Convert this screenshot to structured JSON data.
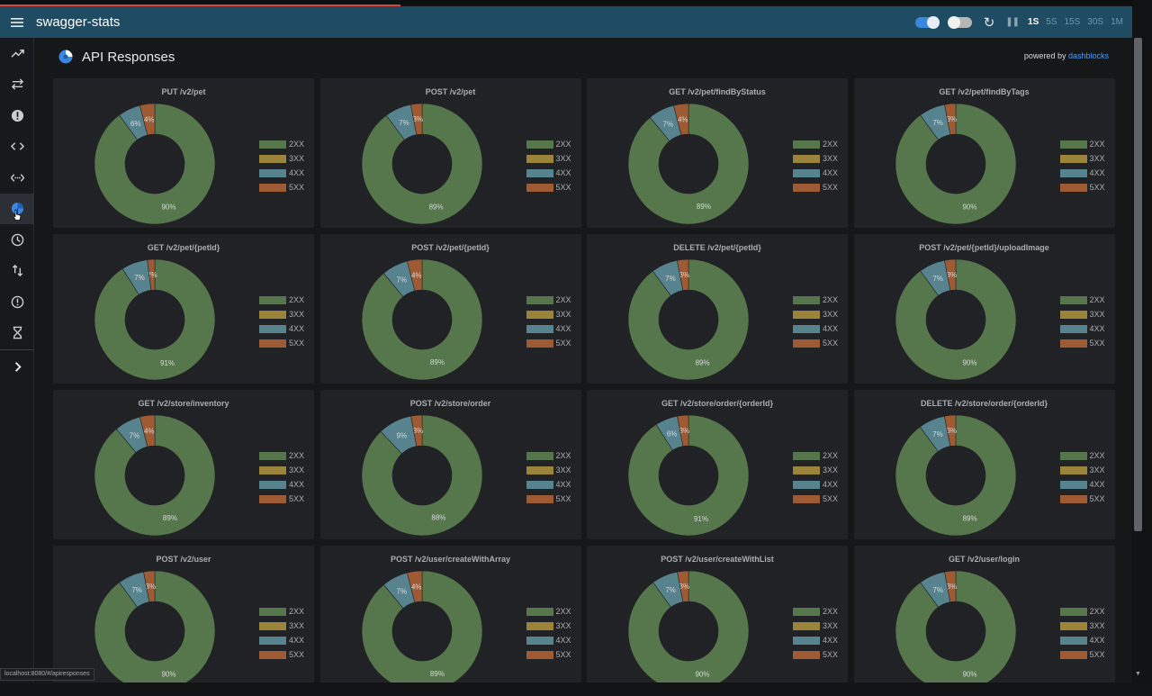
{
  "app": {
    "title": "swagger-stats"
  },
  "header": {
    "interval_options": [
      "1S",
      "5S",
      "15S",
      "30S",
      "1M"
    ],
    "active_interval": "1S",
    "icons": [
      "theme-toggle-icon",
      "autorefresh-toggle-icon",
      "refresh-icon",
      "pause-icon"
    ],
    "pause_glyph": "❚❚",
    "refresh_glyph": "↻"
  },
  "sidebar": {
    "items": [
      {
        "name": "sidebar-item-summary",
        "icon": "trending-up-icon"
      },
      {
        "name": "sidebar-item-requests",
        "icon": "swap-icon"
      },
      {
        "name": "sidebar-item-errors",
        "icon": "alert-circle-icon"
      },
      {
        "name": "sidebar-item-api",
        "icon": "code-icon"
      },
      {
        "name": "sidebar-item-api-operations",
        "icon": "api-ops-icon"
      },
      {
        "name": "sidebar-item-api-responses",
        "icon": "pie-chart-icon",
        "active": true
      },
      {
        "name": "sidebar-item-rates",
        "icon": "clock-icon"
      },
      {
        "name": "sidebar-item-payload",
        "icon": "up-down-icon"
      },
      {
        "name": "sidebar-item-alerts",
        "icon": "info-circle-icon"
      },
      {
        "name": "sidebar-item-longest",
        "icon": "hourglass-icon"
      },
      {
        "name": "sidebar-expand",
        "icon": "chevron-right-icon"
      }
    ]
  },
  "page": {
    "title": "API Responses",
    "powered_by": "powered by",
    "powered_link": "dashblocks"
  },
  "legend": [
    "2XX",
    "3XX",
    "4XX",
    "5XX"
  ],
  "colors": {
    "2XX": "#56764c",
    "3XX": "#9a8439",
    "4XX": "#57838f",
    "5XX": "#9e5b33",
    "header": "#1f4c63",
    "accent": "#3b86e0"
  },
  "chart_data": [
    {
      "type": "pie",
      "title": "PUT /v2/pet",
      "labels": [
        "2XX",
        "3XX",
        "4XX",
        "5XX"
      ],
      "values": [
        90,
        0,
        6,
        4
      ]
    },
    {
      "type": "pie",
      "title": "POST /v2/pet",
      "labels": [
        "2XX",
        "3XX",
        "4XX",
        "5XX"
      ],
      "values": [
        89,
        0,
        7,
        3
      ]
    },
    {
      "type": "pie",
      "title": "GET /v2/pet/findByStatus",
      "labels": [
        "2XX",
        "3XX",
        "4XX",
        "5XX"
      ],
      "values": [
        89,
        0,
        7,
        4
      ]
    },
    {
      "type": "pie",
      "title": "GET /v2/pet/findByTags",
      "labels": [
        "2XX",
        "3XX",
        "4XX",
        "5XX"
      ],
      "values": [
        90,
        0,
        7,
        3
      ]
    },
    {
      "type": "pie",
      "title": "GET /v2/pet/{petId}",
      "labels": [
        "2XX",
        "3XX",
        "4XX",
        "5XX"
      ],
      "values": [
        91,
        0,
        7,
        2
      ]
    },
    {
      "type": "pie",
      "title": "POST /v2/pet/{petId}",
      "labels": [
        "2XX",
        "3XX",
        "4XX",
        "5XX"
      ],
      "values": [
        89,
        0,
        7,
        4
      ]
    },
    {
      "type": "pie",
      "title": "DELETE /v2/pet/{petId}",
      "labels": [
        "2XX",
        "3XX",
        "4XX",
        "5XX"
      ],
      "values": [
        89,
        0,
        7,
        3
      ]
    },
    {
      "type": "pie",
      "title": "POST /v2/pet/{petId}/uploadImage",
      "labels": [
        "2XX",
        "3XX",
        "4XX",
        "5XX"
      ],
      "values": [
        90,
        0,
        7,
        3
      ]
    },
    {
      "type": "pie",
      "title": "GET /v2/store/inventory",
      "labels": [
        "2XX",
        "3XX",
        "4XX",
        "5XX"
      ],
      "values": [
        89,
        0,
        7,
        4
      ]
    },
    {
      "type": "pie",
      "title": "POST /v2/store/order",
      "labels": [
        "2XX",
        "3XX",
        "4XX",
        "5XX"
      ],
      "values": [
        88,
        0,
        9,
        3
      ]
    },
    {
      "type": "pie",
      "title": "GET /v2/store/order/{orderId}",
      "labels": [
        "2XX",
        "3XX",
        "4XX",
        "5XX"
      ],
      "values": [
        91,
        0,
        6,
        3
      ]
    },
    {
      "type": "pie",
      "title": "DELETE /v2/store/order/{orderId}",
      "labels": [
        "2XX",
        "3XX",
        "4XX",
        "5XX"
      ],
      "values": [
        89,
        0,
        7,
        3
      ]
    },
    {
      "type": "pie",
      "title": "POST /v2/user",
      "labels": [
        "2XX",
        "3XX",
        "4XX",
        "5XX"
      ],
      "values": [
        90,
        0,
        7,
        3
      ]
    },
    {
      "type": "pie",
      "title": "POST /v2/user/createWithArray",
      "labels": [
        "2XX",
        "3XX",
        "4XX",
        "5XX"
      ],
      "values": [
        89,
        0,
        7,
        4
      ]
    },
    {
      "type": "pie",
      "title": "POST /v2/user/createWithList",
      "labels": [
        "2XX",
        "3XX",
        "4XX",
        "5XX"
      ],
      "values": [
        90,
        0,
        7,
        3
      ]
    },
    {
      "type": "pie",
      "title": "GET /v2/user/login",
      "labels": [
        "2XX",
        "3XX",
        "4XX",
        "5XX"
      ],
      "values": [
        90,
        0,
        7,
        3
      ]
    }
  ],
  "status_url": "localhost:8080/#/apiresponses"
}
